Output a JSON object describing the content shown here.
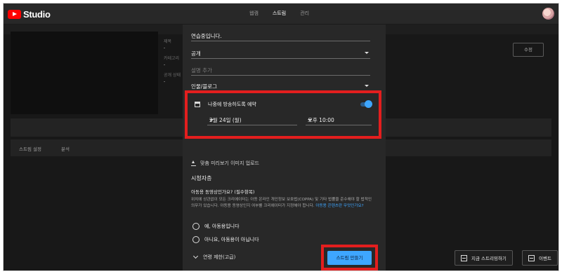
{
  "app": {
    "logo_text": "Studio",
    "logo_icon": "youtube-play-icon"
  },
  "topnav": {
    "items": [
      "웹캠",
      "스트림",
      "관리"
    ],
    "active": "스트림"
  },
  "background": {
    "info_labels": [
      "제목",
      "카테고리",
      "공개 상태"
    ],
    "info_values": [
      "-",
      "-",
      "-"
    ],
    "edit_label": "수정",
    "tabs": [
      "스트림 설정",
      "분석"
    ],
    "go_live_label": "지금 스트리밍하기",
    "event_label": "이벤트"
  },
  "form": {
    "title_value": "연습중입니다.",
    "visibility_value": "공개",
    "description_placeholder": "설명 추가",
    "category_value": "인물/블로그"
  },
  "schedule": {
    "label": "나중에 방송하도록 예약",
    "enabled": true,
    "date_value": "2월 24일 (월)",
    "time_value": "오후 10:00"
  },
  "thumbnail": {
    "label": "맞춤 미리보기 이미지 업로드"
  },
  "audience": {
    "section_title": "시청자층",
    "question": "아동용 동영상인가요? (필수항목)",
    "description": "위치에 상관없이 모든 크리에이터는 아동 온라인 개인정보 보호법(COPPA) 및 기타 법률을 준수해야 할 법적인 의무가 있습니다. 아동용 동영상인지 여부를 크리에이터가 지정해야 합니다.",
    "link_text": "아동용 콘텐츠란 무엇인가요?",
    "option_yes": "예, 아동용입니다",
    "option_no": "아니요, 아동용이 아닙니다",
    "advanced": "연령 제한(고급)"
  },
  "actions": {
    "create_stream_label": "스트림 만들기"
  },
  "colors": {
    "accent": "#3ea6ff",
    "highlight": "#e31e1e",
    "brand": "#ff0000"
  }
}
